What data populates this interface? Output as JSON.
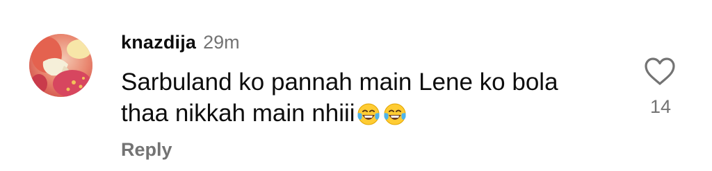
{
  "comment": {
    "username": "knazdija",
    "timestamp": "29m",
    "text_lines": [
      "Sarbuland ko pannah main Lene ko bola",
      "thaa nikkah main nhiii"
    ],
    "emojis": [
      "face-with-tears-of-joy",
      "face-with-tears-of-joy"
    ],
    "reply_label": "Reply",
    "like_count": "14",
    "heart_icon": "heart-outline-icon"
  },
  "colors": {
    "primary_text": "#0d0d0d",
    "secondary_text": "#737373",
    "background": "#ffffff"
  }
}
